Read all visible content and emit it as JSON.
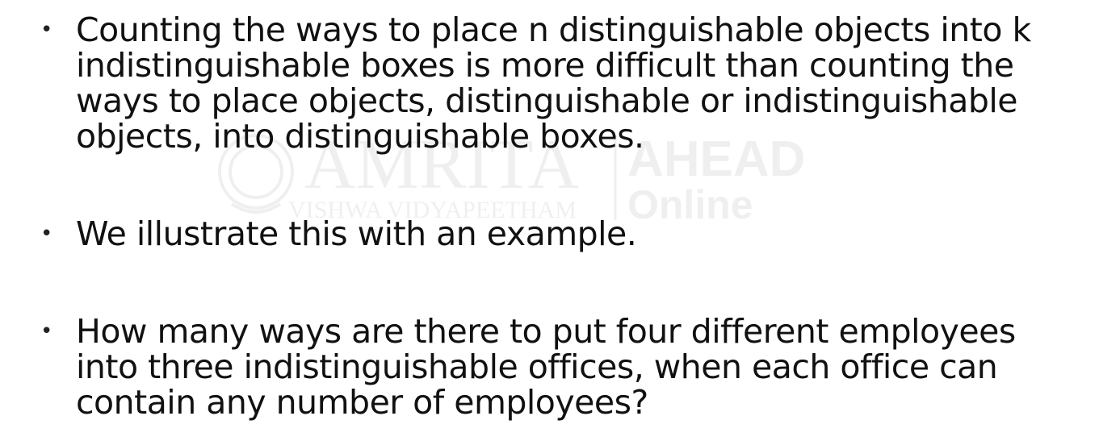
{
  "watermark": {
    "brand_left": "AMRITA",
    "brand_left_sub": "VISHWA VIDYAPEETHAM",
    "brand_right": "AHEAD",
    "brand_right_sub": "Online",
    "seal_icon": "university-seal-icon"
  },
  "bullet_symbol": "•",
  "bullets": [
    {
      "lines": "Counting the ways to place n distinguishable objects into k\nindistinguishable boxes is more difficult than counting the\nways to place objects, distinguishable or indistinguishable\nobjects, into distinguishable boxes."
    },
    {
      "lines": "We illustrate this with an example."
    },
    {
      "lines": "How many ways are there to put four different employees\ninto three indistinguishable offices, when each office can\ncontain any number of employees?"
    }
  ]
}
